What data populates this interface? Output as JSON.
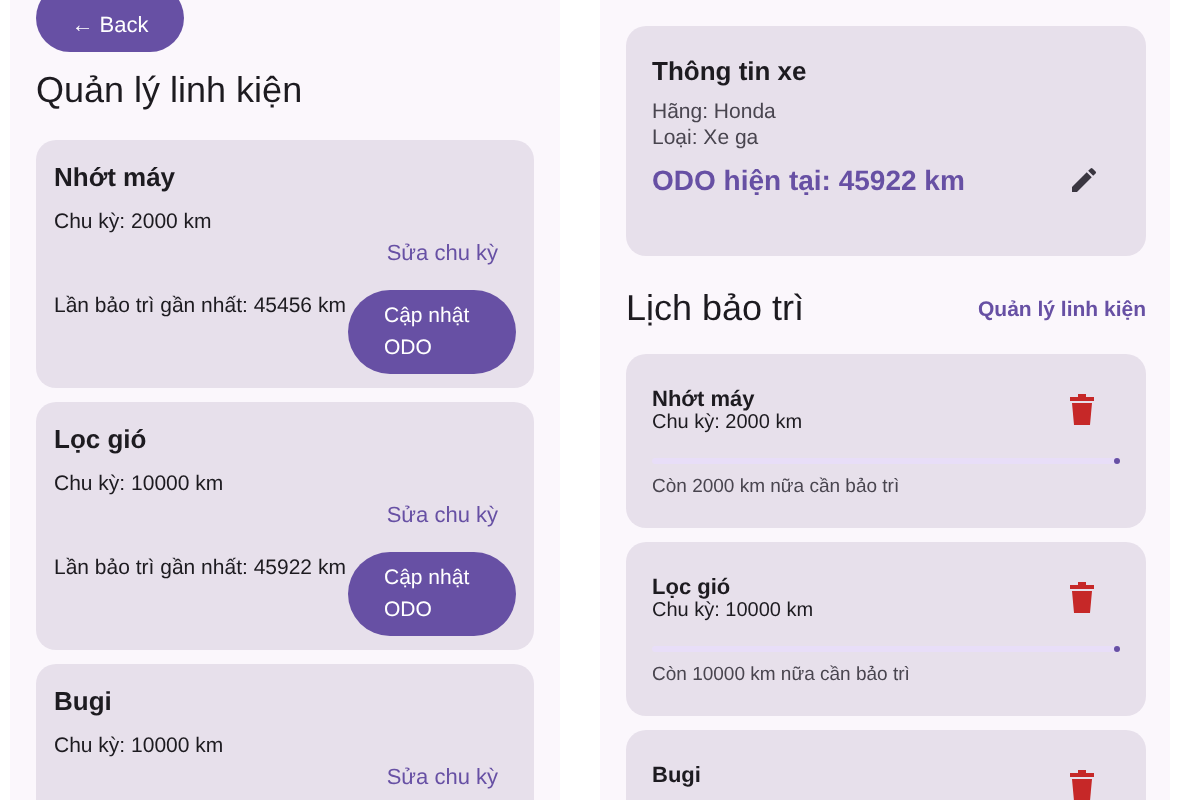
{
  "left_screen": {
    "back_button": "← Back",
    "title": "Quản lý linh kiện",
    "parts": [
      {
        "name": "Nhớt máy",
        "cycle": "Chu kỳ: 2000 km",
        "edit_link": "Sửa chu kỳ",
        "last_service": "Lần bảo trì gần nhất: 45456 km",
        "update_button": "Cập nhật ODO"
      },
      {
        "name": "Lọc gió",
        "cycle": "Chu kỳ: 10000 km",
        "edit_link": "Sửa chu kỳ",
        "last_service": "Lần bảo trì gần nhất: 45922 km",
        "update_button": "Cập nhật ODO"
      },
      {
        "name": "Bugi",
        "cycle": "Chu kỳ: 10000 km",
        "edit_link": "Sửa chu kỳ"
      }
    ]
  },
  "right_screen": {
    "vehicle_card": {
      "title": "Thông tin xe",
      "brand": "Hãng: Honda",
      "type": "Loại: Xe ga",
      "odometer": "ODO hiện tại: 45922 km"
    },
    "schedule_title": "Lịch bảo trì",
    "manage_link": "Quản lý linh kiện",
    "schedule": [
      {
        "name": "Nhớt máy",
        "cycle": "Chu kỳ: 2000 km",
        "level": 0,
        "remaining": "Còn 2000 km nữa cần bảo trì"
      },
      {
        "name": "Lọc gió",
        "cycle": "Chu kỳ: 10000 km",
        "level": 0,
        "remaining": "Còn 10000 km nữa cần bảo trì"
      },
      {
        "name": "Bugi"
      }
    ]
  }
}
